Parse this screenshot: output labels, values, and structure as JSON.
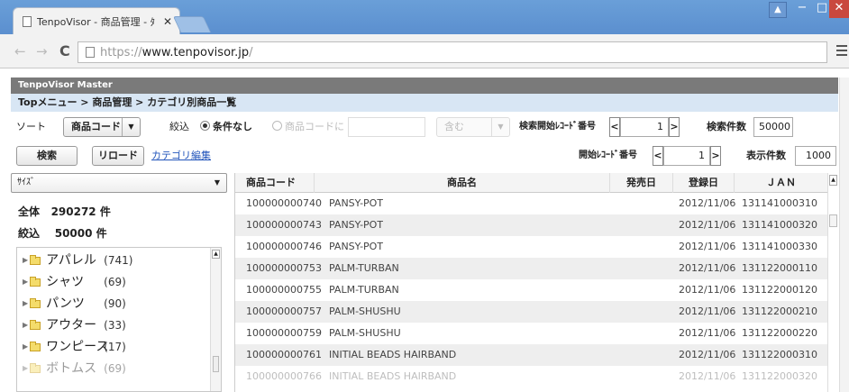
{
  "browser": {
    "tab_title": "TenpoVisor - 商品管理 - ﾀ",
    "tab_close": "✕",
    "url_scheme": "https://",
    "url_host": "www.tenpovisor.jp",
    "url_path": "/",
    "back_icon": "←",
    "forward_icon": "→",
    "reload_icon": "C",
    "user_icon": "▲",
    "minimize": "−",
    "maximize": "□",
    "close": "✕"
  },
  "app": {
    "header": "TenpoVisor Master",
    "breadcrumb": "Topメニュー > 商品管理 > カテゴリ別商品一覧"
  },
  "toolbar": {
    "sort_label": "ソート",
    "sort_value": "商品コード",
    "filter_label": "絞込",
    "radio_none_label": "条件なし",
    "radio_code_label": "商品コードに",
    "code_input": "",
    "contains_value": "含む",
    "search_start_label": "検索開始ﾚｺｰﾄﾞ番号",
    "search_start_value": "1",
    "search_count_label": "検索件数",
    "search_count_value": "50000",
    "search_button": "検索",
    "reload_button": "リロード",
    "category_edit_link": "カテゴリ編集",
    "start_record_label": "開始ﾚｺｰﾄﾞ番号",
    "start_record_value": "1",
    "display_count_label": "表示件数",
    "display_count_value": "1000",
    "step_prev": "<",
    "step_next": ">"
  },
  "left": {
    "size_select": "ｻｲｽﾞ",
    "total_label": "全体",
    "total_value": "290272 件",
    "filtered_label": "絞込",
    "filtered_value": "50000 件",
    "tree": [
      {
        "name": "アパレル",
        "count": "(741)"
      },
      {
        "name": "シャツ",
        "count": "(69)"
      },
      {
        "name": "パンツ",
        "count": "(90)"
      },
      {
        "name": "アウター",
        "count": "(33)"
      },
      {
        "name": "ワンピース",
        "count": "(17)"
      },
      {
        "name": "ボトムス",
        "count": "(69)"
      }
    ]
  },
  "grid": {
    "columns": [
      "商品コード",
      "商品名",
      "発売日",
      "登録日",
      "ＪＡＮ"
    ],
    "rows": [
      {
        "code": "100000000740",
        "name": "PANSY-POT",
        "release": "",
        "registered": "2012/11/06",
        "jan": "131141000310"
      },
      {
        "code": "100000000743",
        "name": "PANSY-POT",
        "release": "",
        "registered": "2012/11/06",
        "jan": "131141000320"
      },
      {
        "code": "100000000746",
        "name": "PANSY-POT",
        "release": "",
        "registered": "2012/11/06",
        "jan": "131141000330"
      },
      {
        "code": "100000000753",
        "name": "PALM-TURBAN",
        "release": "",
        "registered": "2012/11/06",
        "jan": "131122000110"
      },
      {
        "code": "100000000755",
        "name": "PALM-TURBAN",
        "release": "",
        "registered": "2012/11/06",
        "jan": "131122000120"
      },
      {
        "code": "100000000757",
        "name": "PALM-SHUSHU",
        "release": "",
        "registered": "2012/11/06",
        "jan": "131122000210"
      },
      {
        "code": "100000000759",
        "name": "PALM-SHUSHU",
        "release": "",
        "registered": "2012/11/06",
        "jan": "131122000220"
      },
      {
        "code": "100000000761",
        "name": "INITIAL BEADS HAIRBAND",
        "release": "",
        "registered": "2012/11/06",
        "jan": "131122000310"
      },
      {
        "code": "100000000766",
        "name": "INITIAL BEADS HAIRBAND",
        "release": "",
        "registered": "2012/11/06",
        "jan": "131122000320"
      }
    ]
  }
}
